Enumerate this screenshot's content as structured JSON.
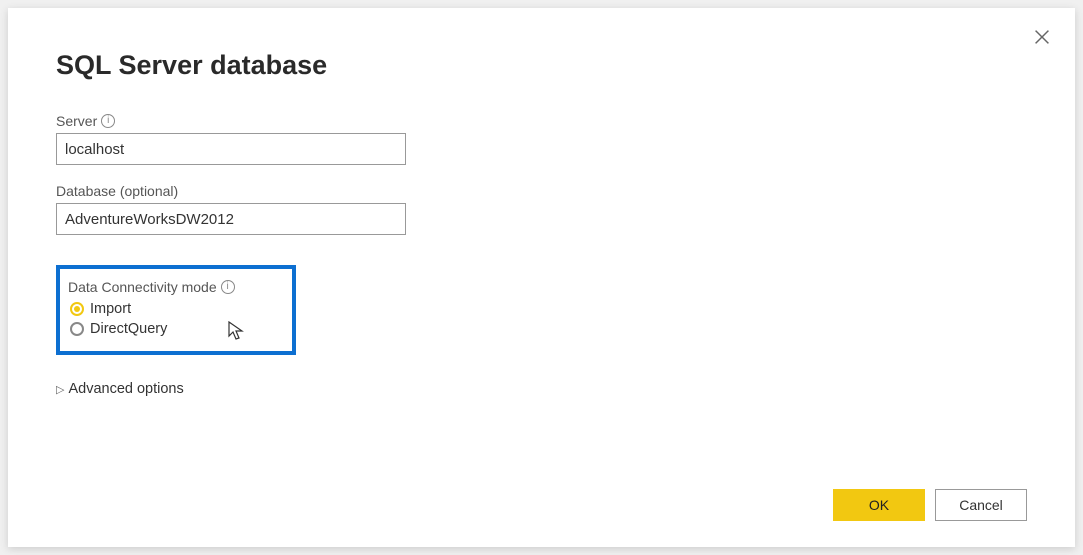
{
  "dialog": {
    "title": "SQL Server database",
    "server_label": "Server",
    "server_value": "localhost",
    "database_label": "Database (optional)",
    "database_value": "AdventureWorksDW2012",
    "connectivity_label": "Data Connectivity mode",
    "radios": [
      {
        "label": "Import",
        "selected": true
      },
      {
        "label": "DirectQuery",
        "selected": false
      }
    ],
    "advanced_label": "Advanced options",
    "ok_label": "OK",
    "cancel_label": "Cancel"
  }
}
